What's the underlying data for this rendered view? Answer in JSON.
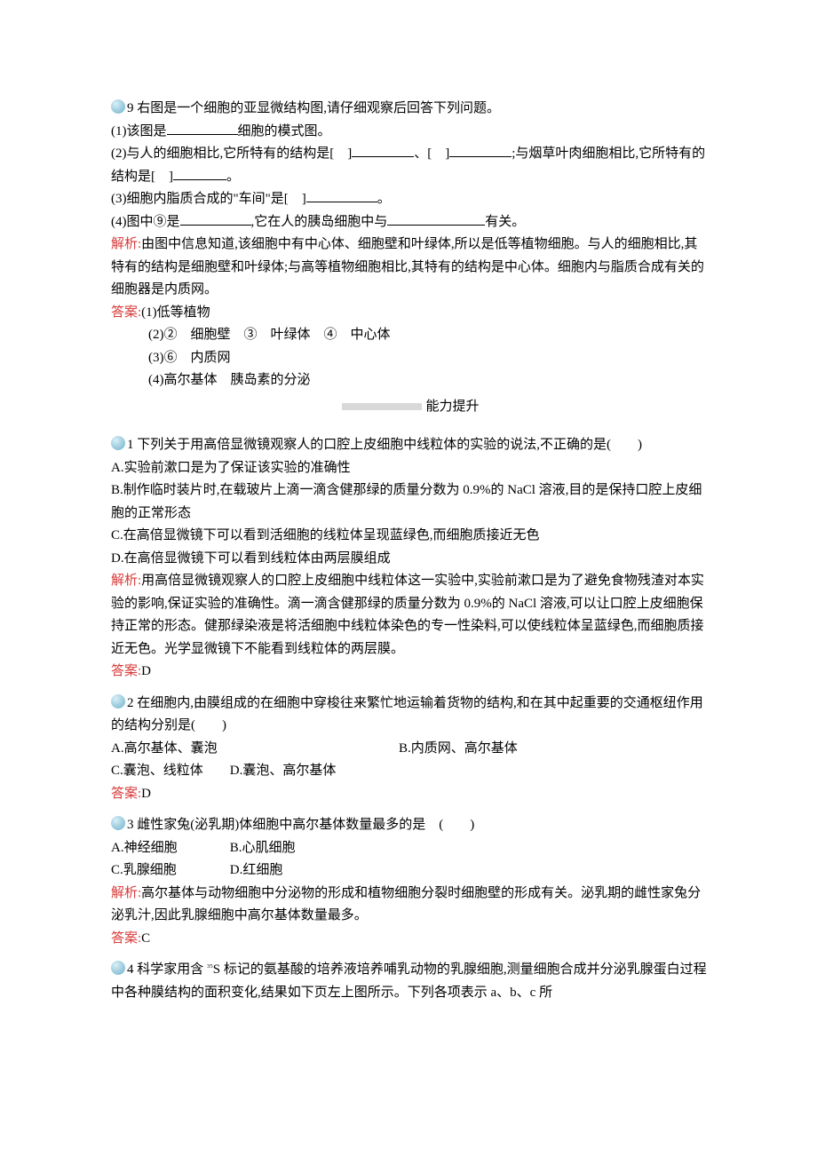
{
  "q9": {
    "num": "9",
    "stem": "右图是一个细胞的亚显微结构图,请仔细观察后回答下列问题。",
    "p1a": "(1)该图是",
    "p1b": "细胞的模式图。",
    "p2a": "(2)与人的细胞相比,它所特有的结构是[　]",
    "p2b": "、[　]",
    "p2c": ";与烟草叶肉细胞相比,它所特有的结构是[　]",
    "p2d": "。",
    "p3a": "(3)细胞内脂质合成的\"车间\"是[　]",
    "p3b": "。",
    "p4a": "(4)图中⑨是",
    "p4b": ",它在人的胰岛细胞中与",
    "p4c": "有关。",
    "exp_label": "解析:",
    "exp": "由图中信息知道,该细胞中有中心体、细胞壁和叶绿体,所以是低等植物细胞。与人的细胞相比,其特有的结构是细胞壁和叶绿体;与高等植物细胞相比,其特有的结构是中心体。细胞内与脂质合成有关的细胞器是内质网。",
    "ans_label": "答案:",
    "a1": "(1)低等植物",
    "a2": "(2)②　细胞壁　③　叶绿体　④　中心体",
    "a3": "(3)⑥　内质网",
    "a4": "(4)高尔基体　胰岛素的分泌"
  },
  "divider": {
    "title": "能力提升"
  },
  "q1": {
    "num": "1",
    "stem": "下列关于用高倍显微镜观察人的口腔上皮细胞中线粒体的实验的说法,不正确的是(　　)",
    "optA": "A.实验前漱口是为了保证该实验的准确性",
    "optB": "B.制作临时装片时,在载玻片上滴一滴含健那绿的质量分数为 0.9%的 NaCl 溶液,目的是保持口腔上皮细胞的正常形态",
    "optC": "C.在高倍显微镜下可以看到活细胞的线粒体呈现蓝绿色,而细胞质接近无色",
    "optD": "D.在高倍显微镜下可以看到线粒体由两层膜组成",
    "exp_label": "解析:",
    "exp": "用高倍显微镜观察人的口腔上皮细胞中线粒体这一实验中,实验前漱口是为了避免食物残渣对本实验的影响,保证实验的准确性。滴一滴含健那绿的质量分数为 0.9%的 NaCl 溶液,可以让口腔上皮细胞保持正常的形态。健那绿染液是将活细胞中线粒体染色的专一性染料,可以使线粒体呈蓝绿色,而细胞质接近无色。光学显微镜下不能看到线粒体的两层膜。",
    "ans_label": "答案:",
    "ans": "D"
  },
  "q2": {
    "num": "2",
    "stem": "在细胞内,由膜组成的在细胞中穿梭往来繁忙地运输着货物的结构,和在其中起重要的交通枢纽作用的结构分别是(　　)",
    "optA": "A.高尔基体、囊泡",
    "optB": "B.内质网、高尔基体",
    "optC": "C.囊泡、线粒体",
    "optD": "D.囊泡、高尔基体",
    "ans_label": "答案:",
    "ans": "D"
  },
  "q3": {
    "num": "3",
    "stem": "雌性家兔(泌乳期)体细胞中高尔基体数量最多的是　(　　)",
    "optA": "A.神经细胞",
    "optB": "B.心肌细胞",
    "optC": "C.乳腺细胞",
    "optD": "D.红细胞",
    "exp_label": "解析:",
    "exp": "高尔基体与动物细胞中分泌物的形成和植物细胞分裂时细胞壁的形成有关。泌乳期的雌性家兔分泌乳汁,因此乳腺细胞中高尔基体数量最多。",
    "ans_label": "答案:",
    "ans": "C"
  },
  "q4": {
    "num": "4",
    "stem_a": "科学家用含 ",
    "stem_sup": "35",
    "stem_b": "S 标记的氨基酸的培养液培养哺乳动物的乳腺细胞,测量细胞合成并分泌乳腺蛋白过程中各种膜结构的面积变化,结果如下页左上图所示。下列各项表示 a、b、c 所"
  }
}
